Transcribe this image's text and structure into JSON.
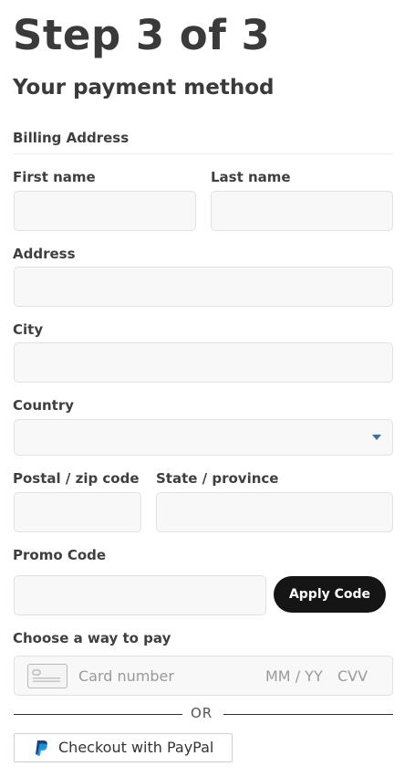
{
  "header": {
    "step_title": "Step 3 of 3",
    "subtitle": "Your payment method"
  },
  "billing": {
    "section_label": "Billing Address",
    "first_name_label": "First name",
    "first_name_value": "",
    "last_name_label": "Last name",
    "last_name_value": "",
    "address_label": "Address",
    "address_value": "",
    "city_label": "City",
    "city_value": "",
    "country_label": "Country",
    "country_value": "",
    "postal_label": "Postal / zip code",
    "postal_value": "",
    "state_label": "State / province",
    "state_value": ""
  },
  "promo": {
    "label": "Promo Code",
    "value": "",
    "apply_label": "Apply Code"
  },
  "payment": {
    "label": "Choose a way to pay",
    "card_number_placeholder": "Card number",
    "expiry_placeholder": "MM / YY",
    "cvv_placeholder": "CVV",
    "or_text": "OR",
    "paypal_label": "Checkout with PayPal"
  },
  "icons": {
    "card": "credit-card-icon",
    "paypal": "paypal-logo-icon",
    "dropdown": "chevron-down-icon"
  },
  "colors": {
    "field_bg": "#f8f8f8",
    "field_border": "#e1e1e1",
    "button_bg": "#151515",
    "caret": "#3b6fa0",
    "paypal_dark": "#253b80",
    "paypal_light": "#179bd7"
  }
}
